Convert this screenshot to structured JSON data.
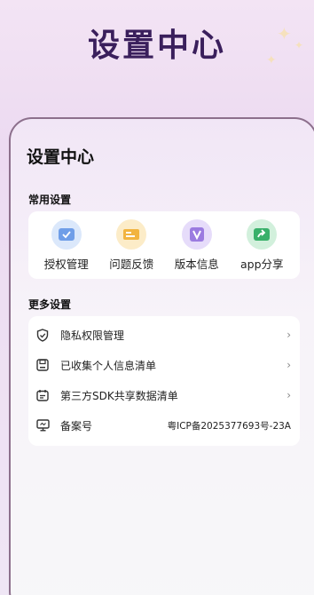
{
  "header": {
    "title": "设置中心"
  },
  "card": {
    "title": "设置中心"
  },
  "common": {
    "section_label": "常用设置",
    "items": [
      {
        "label": "授权管理",
        "icon": "authorize-icon",
        "color": "#6f9ee8"
      },
      {
        "label": "问题反馈",
        "icon": "feedback-icon",
        "color": "#f2b440"
      },
      {
        "label": "版本信息",
        "icon": "version-icon",
        "color": "#9b7be0"
      },
      {
        "label": "app分享",
        "icon": "share-icon",
        "color": "#39b06a"
      }
    ]
  },
  "more": {
    "section_label": "更多设置",
    "items": [
      {
        "label": "隐私权限管理",
        "icon": "shield-icon",
        "trailing": "›"
      },
      {
        "label": "已收集个人信息清单",
        "icon": "save-icon",
        "trailing": "›"
      },
      {
        "label": "第三方SDK共享数据清单",
        "icon": "calendar-icon",
        "trailing": "›"
      },
      {
        "label": "备案号",
        "icon": "monitor-icon",
        "value": "粤ICP备2025377693号-23A"
      }
    ]
  }
}
